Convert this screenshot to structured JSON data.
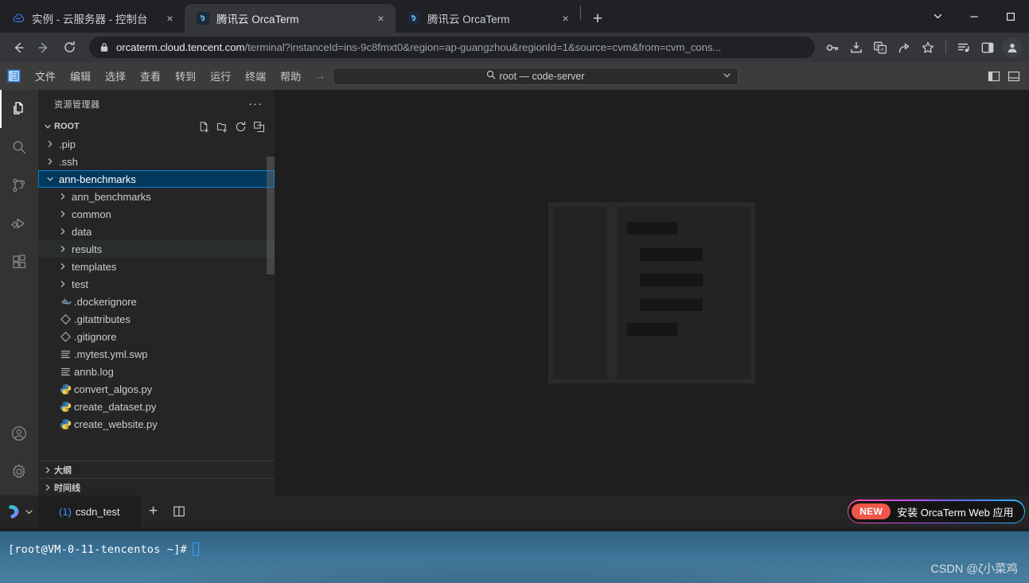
{
  "browser": {
    "tabs": [
      {
        "title": "实例 - 云服务器 - 控制台",
        "favicon": "tencent-cloud-icon",
        "active": false,
        "close_label": "×"
      },
      {
        "title": "腾讯云 OrcaTerm",
        "favicon": "orcaterm-icon",
        "active": true,
        "close_label": "×"
      },
      {
        "title": "腾讯云 OrcaTerm",
        "favicon": "orcaterm-icon",
        "active": false,
        "close_label": "×"
      }
    ],
    "new_tab_label": "+",
    "window_controls": {
      "chevron": "⌄",
      "minimize": "—",
      "maximize": "▢"
    },
    "toolbar": {
      "back": "back-icon",
      "forward": "forward-icon",
      "reload": "reload-icon",
      "url_host": "orcaterm.cloud.tencent.com",
      "url_path": "/terminal?instanceId=ins-9c8fmxt0&region=ap-guangzhou&regionId=1&source=cvm&from=cvm_cons...",
      "icons": [
        "key-icon",
        "download-icon",
        "translate-icon",
        "share-icon",
        "bookmark-star-icon",
        "reading-list-icon",
        "side-panel-icon",
        "profile-avatar-icon"
      ]
    }
  },
  "vscode": {
    "menus": [
      "文件",
      "编辑",
      "选择",
      "查看",
      "转到",
      "运行",
      "终端",
      "帮助"
    ],
    "quick_input": {
      "text": "root — code-server",
      "search_icon": "search-icon",
      "chevron": "chevron-down-icon"
    },
    "nav": {
      "back": "←",
      "forward": "→"
    },
    "layout_icons": [
      "toggle-primary-sidebar-icon",
      "toggle-panel-icon"
    ],
    "activitybar": [
      {
        "name": "explorer",
        "icon": "files-icon",
        "active": true
      },
      {
        "name": "search",
        "icon": "search-icon",
        "active": false
      },
      {
        "name": "source-control",
        "icon": "source-control-icon",
        "active": false
      },
      {
        "name": "run-debug",
        "icon": "run-debug-icon",
        "active": false
      },
      {
        "name": "extensions",
        "icon": "extensions-icon",
        "active": false
      },
      {
        "name": "account",
        "icon": "account-icon",
        "active": false
      },
      {
        "name": "settings",
        "icon": "gear-icon",
        "active": false
      }
    ],
    "sidebar": {
      "title": "资源管理器",
      "more_label": "···",
      "root_section": {
        "label": "ROOT",
        "expanded": true,
        "actions": [
          "new-file-icon",
          "new-folder-icon",
          "refresh-icon",
          "collapse-all-icon"
        ]
      },
      "tree": [
        {
          "label": ".pip",
          "type": "folder",
          "expanded": false,
          "depth": 1,
          "state": "normal"
        },
        {
          "label": ".ssh",
          "type": "folder",
          "expanded": false,
          "depth": 1,
          "state": "normal"
        },
        {
          "label": "ann-benchmarks",
          "type": "folder",
          "expanded": true,
          "depth": 1,
          "state": "selected"
        },
        {
          "label": "ann_benchmarks",
          "type": "folder",
          "expanded": false,
          "depth": 2,
          "state": "normal"
        },
        {
          "label": "common",
          "type": "folder",
          "expanded": false,
          "depth": 2,
          "state": "normal"
        },
        {
          "label": "data",
          "type": "folder",
          "expanded": false,
          "depth": 2,
          "state": "normal"
        },
        {
          "label": "results",
          "type": "folder",
          "expanded": false,
          "depth": 2,
          "state": "hover"
        },
        {
          "label": "templates",
          "type": "folder",
          "expanded": false,
          "depth": 2,
          "state": "normal"
        },
        {
          "label": "test",
          "type": "folder",
          "expanded": false,
          "depth": 2,
          "state": "normal"
        },
        {
          "label": ".dockerignore",
          "type": "file",
          "icon": "docker-icon",
          "depth": 2,
          "state": "normal"
        },
        {
          "label": ".gitattributes",
          "type": "file",
          "icon": "git-icon",
          "depth": 2,
          "state": "normal"
        },
        {
          "label": ".gitignore",
          "type": "file",
          "icon": "git-icon",
          "depth": 2,
          "state": "normal"
        },
        {
          "label": ".mytest.yml.swp",
          "type": "file",
          "icon": "text-icon",
          "depth": 2,
          "state": "normal"
        },
        {
          "label": "annb.log",
          "type": "file",
          "icon": "text-icon",
          "depth": 2,
          "state": "normal"
        },
        {
          "label": "convert_algos.py",
          "type": "file",
          "icon": "python-icon",
          "depth": 2,
          "state": "normal"
        },
        {
          "label": "create_dataset.py",
          "type": "file",
          "icon": "python-icon",
          "depth": 2,
          "state": "normal"
        },
        {
          "label": "create_website.py",
          "type": "file",
          "icon": "python-icon",
          "depth": 2,
          "state": "normal"
        }
      ],
      "bottom_sections": [
        {
          "label": "大纲",
          "expanded": false
        },
        {
          "label": "时间线",
          "expanded": false
        }
      ]
    },
    "editor": {
      "placeholder": "skeleton-loading-placeholder"
    },
    "panel": {
      "orca_logo": "orcaterm-logo-icon",
      "orca_chevron": "chevron-down-icon",
      "tab": {
        "count": "(1)",
        "name": "csdn_test"
      },
      "new_terminal_label": "+",
      "split_terminal_icon": "split-editor-icon",
      "banner": {
        "badge": "NEW",
        "text": "安装 OrcaTerm Web 应用"
      },
      "toolbar_icons": [
        "code-snippet-icon",
        "text-format-icon",
        "folder-icon",
        "edit-pencil-icon",
        "gauge-icon"
      ]
    }
  },
  "terminal": {
    "prompt": "[root@VM-0-11-tencentos ~]#",
    "cursor": true
  },
  "watermark": "CSDN @ζ小菜鸡",
  "colors": {
    "accent": "#007fd4",
    "selection": "#04395e",
    "browser_bg": "#202124",
    "vscode_bg": "#1e1e1e",
    "sidebar_bg": "#252526",
    "terminal_bg": "#3d7396",
    "new_badge": "#f0564a",
    "green_status": "#3fb950"
  }
}
